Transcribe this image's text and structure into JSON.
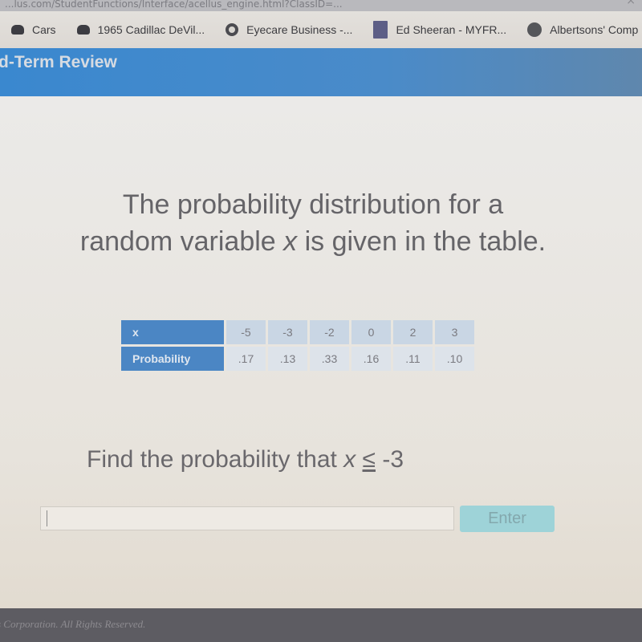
{
  "browser": {
    "url_fragment": "...lus.com/StudentFunctions/Interface/acellus_engine.html?ClassID=...",
    "bookmarks": [
      {
        "label": "Cars",
        "icon": "car-icon"
      },
      {
        "label": "1965 Cadillac DeVil...",
        "icon": "car-icon"
      },
      {
        "label": "Eyecare Business -...",
        "icon": "eyecare-icon"
      },
      {
        "label": "Ed Sheeran - MYFR...",
        "icon": "album-icon"
      },
      {
        "label": "Albertsons' Comp",
        "icon": "globe-icon"
      }
    ]
  },
  "header": {
    "title": "d-Term Review"
  },
  "question": {
    "line1": "The probability distribution for a",
    "line2_pre": "random variable ",
    "line2_var": "x",
    "line2_post": " is given in the table."
  },
  "table": {
    "row_headers": [
      "x",
      "Probability"
    ],
    "x_values": [
      "-5",
      "-3",
      "-2",
      "0",
      "2",
      "3"
    ],
    "probabilities": [
      ".17",
      ".13",
      ".33",
      ".16",
      ".11",
      ".10"
    ]
  },
  "prompt": {
    "text": "Find the probability that ",
    "var": "x",
    "operator": "≤",
    "value": " -3"
  },
  "answer": {
    "value": "",
    "placeholder": ""
  },
  "enter_button": {
    "label": "Enter"
  },
  "footer": {
    "text": "s Corporation. All Rights Reserved."
  }
}
